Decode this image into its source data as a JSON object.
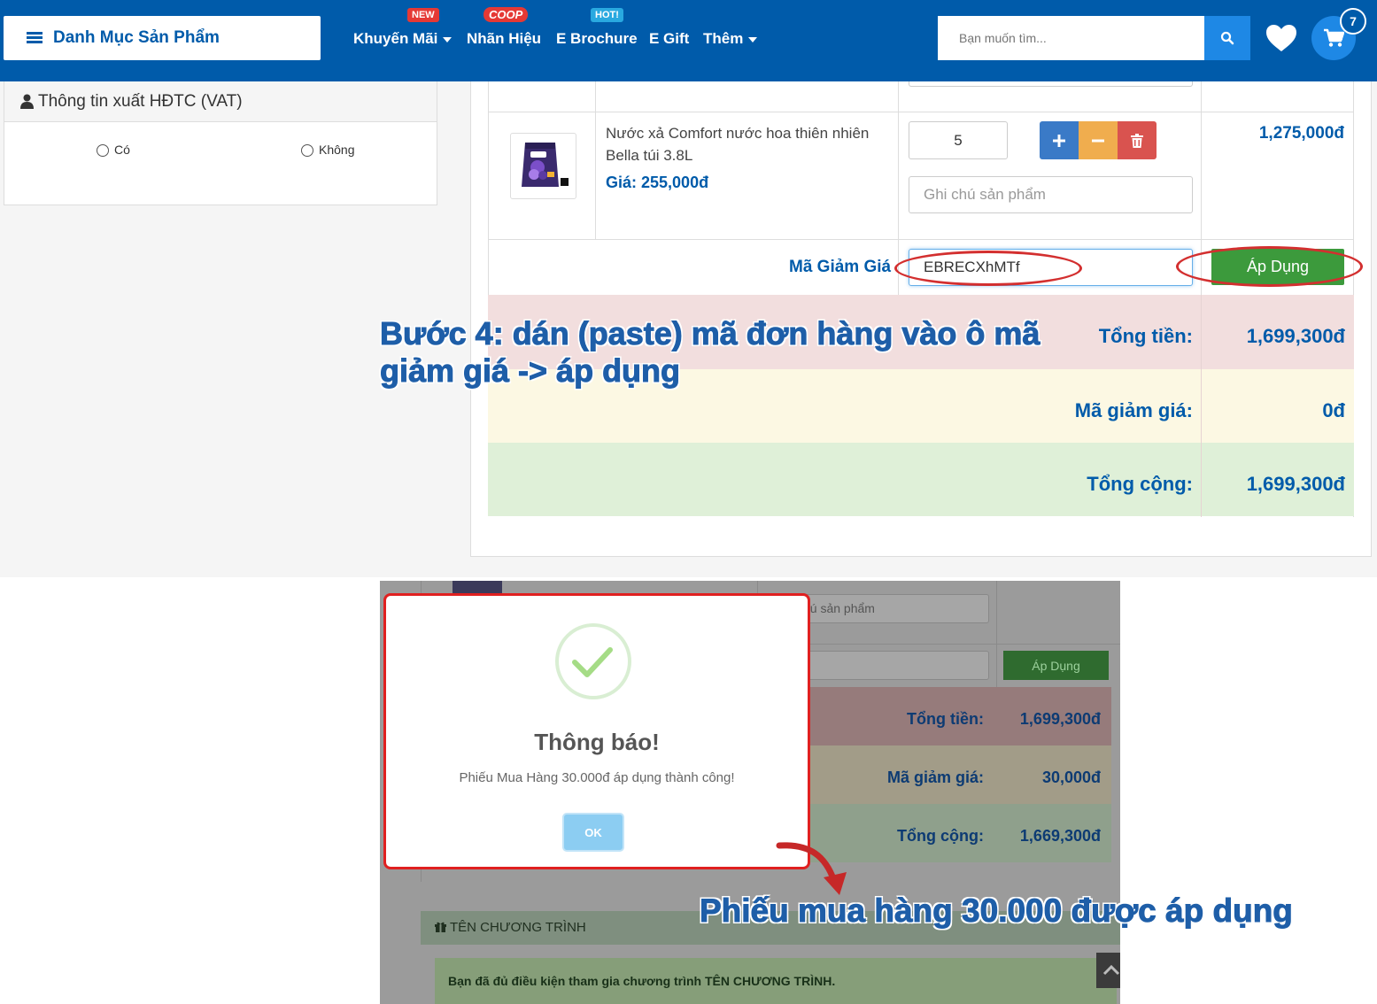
{
  "header": {
    "category_label": "Danh Mục Sản Phẩm",
    "nav": [
      {
        "label": "Khuyến Mãi",
        "badge": "NEW"
      },
      {
        "label": "Nhãn Hiệu",
        "badge": "COOP"
      },
      {
        "label": "E Brochure",
        "badge": "HOT!"
      },
      {
        "label": "E Gift"
      },
      {
        "label": "Thêm"
      }
    ],
    "search_placeholder": "Bạn muốn tìm...",
    "cart_count": "7",
    "colors": {
      "primary": "#005baa",
      "accent": "#1e88e5",
      "badge_red": "#e53935"
    }
  },
  "vat": {
    "title": "Thông tin xuất HĐTC (VAT)",
    "options": [
      "Có",
      "Không"
    ]
  },
  "cart": {
    "item": {
      "name": "Nước xả Comfort nước hoa thiên nhiên Bella túi 3.8L",
      "price": "Giá: 255,000đ",
      "quantity": "5",
      "note_placeholder": "Ghi chú sản phẩm",
      "line_total": "1,275,000đ"
    },
    "coupon": {
      "label": "Mã Giảm Giá",
      "value": "EBRECXhMTf",
      "apply_label": "Áp Dụng"
    },
    "summary": [
      {
        "label": "Tổng tiền:",
        "value": "1,699,300đ",
        "color": "#f2dede"
      },
      {
        "label": "Mã giảm giá:",
        "value": "0đ",
        "color": "#fcf8e3"
      },
      {
        "label": "Tổng cộng:",
        "value": "1,699,300đ",
        "color": "#dff0d8"
      }
    ]
  },
  "annotation_step4": "Bước 4: dán (paste) mã đơn hàng vào ô mã giảm giá -> áp dụng",
  "result": {
    "note_placeholder": "chú sản phẩm",
    "apply_label": "Áp Dụng",
    "summary": [
      {
        "label": "Tổng tiền:",
        "value": "1,699,300đ"
      },
      {
        "label": "Mã giảm giá:",
        "value": "30,000đ"
      },
      {
        "label": "Tổng cộng:",
        "value": "1,669,300đ"
      }
    ],
    "program_title": "TÊN CHƯƠNG TRÌNH",
    "program_message": "Bạn đã đủ điều kiện tham gia chương trình TÊN CHƯƠNG TRÌNH.",
    "modal": {
      "title": "Thông báo!",
      "message": "Phiếu Mua Hàng 30.000đ áp dụng thành công!",
      "ok_label": "OK"
    }
  },
  "annotation_result": "Phiếu mua hàng 30.000 được áp dụng"
}
